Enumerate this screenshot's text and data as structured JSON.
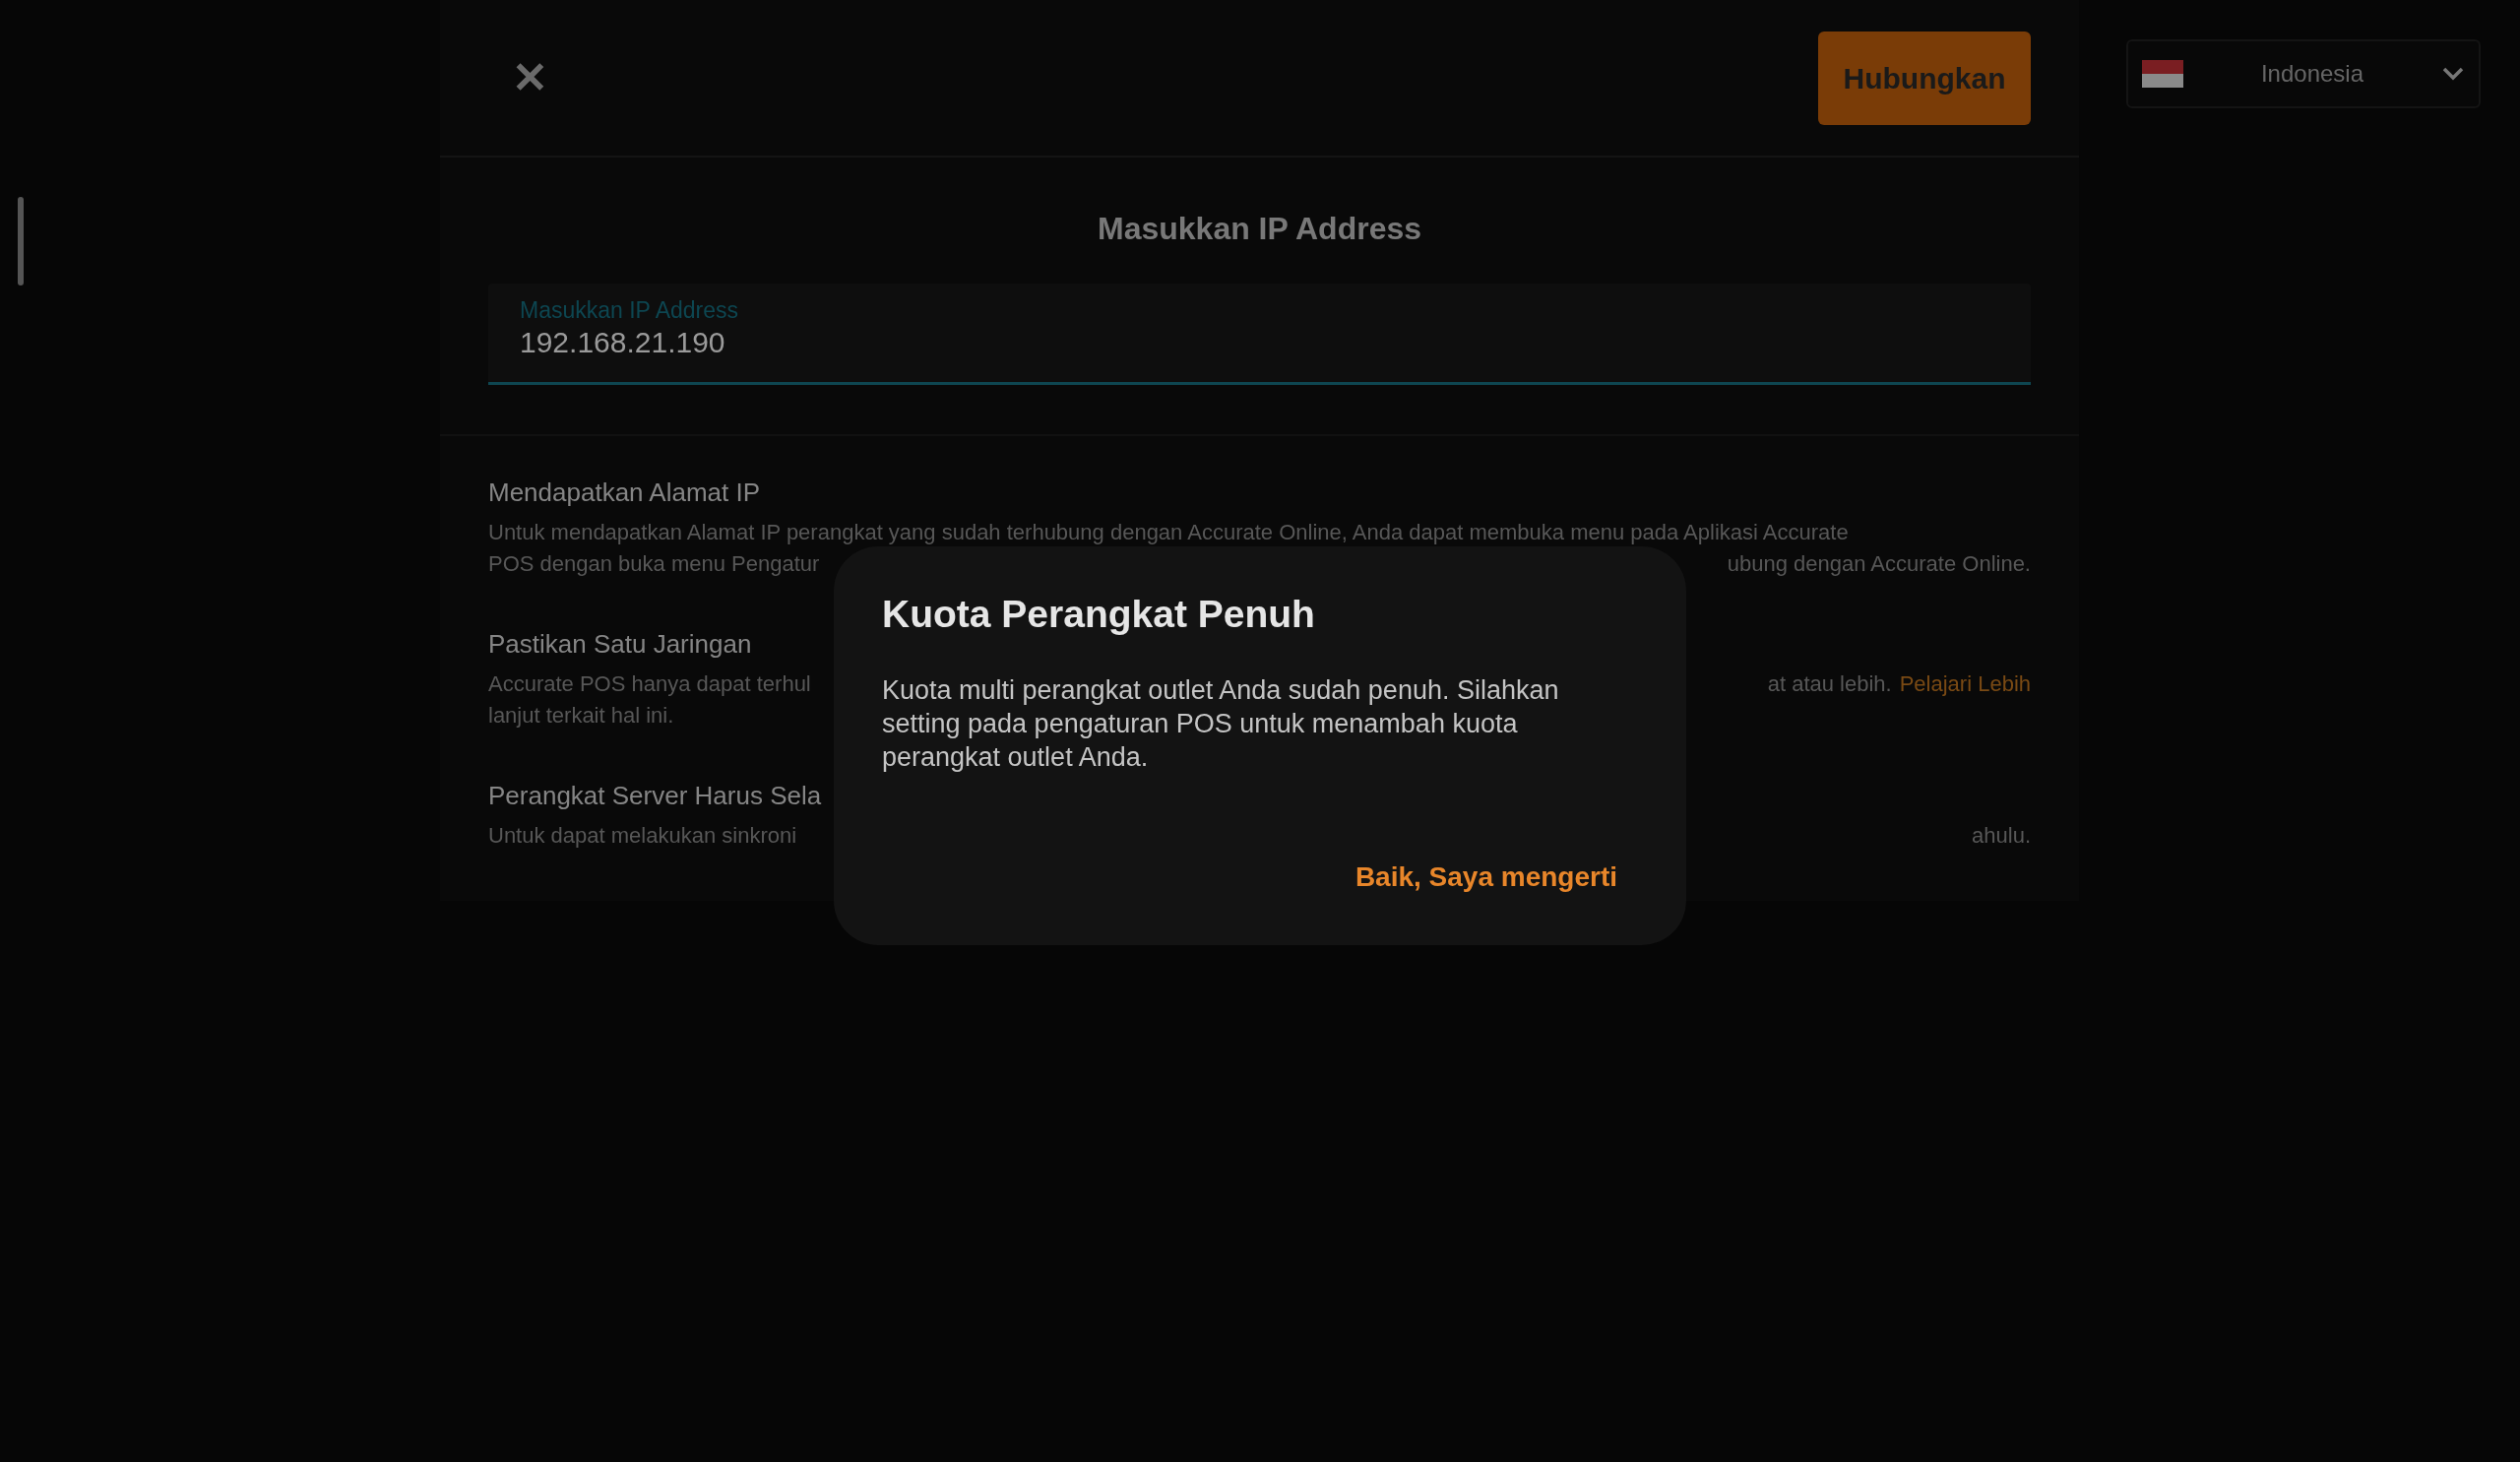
{
  "header": {
    "close_label": "✕",
    "connect_button": "Hubungkan"
  },
  "language": {
    "label": "Indonesia"
  },
  "ip_section": {
    "title": "Masukkan IP Address",
    "field": {
      "label": "Masukkan IP Address",
      "value": "192.168.21.190"
    }
  },
  "help_items": [
    {
      "title": "Mendapatkan Alamat IP",
      "lines": [
        {
          "left": "Untuk mendapatkan Alamat IP perangkat yang sudah terhubung dengan Accurate Online, Anda dapat membuka menu pada Aplikasi Accurate"
        },
        {
          "left": "POS dengan buka menu Pengatur",
          "right": "ubung dengan Accurate Online."
        }
      ]
    },
    {
      "title": "Pastikan Satu Jaringan",
      "lines": [
        {
          "left": "Accurate POS hanya dapat terhul",
          "right": "at atau lebih.",
          "link": "Pelajari Lebih"
        },
        {
          "left": "lanjut terkait hal ini."
        }
      ]
    },
    {
      "title": "Perangkat Server Harus Sela",
      "lines": [
        {
          "left": "Untuk dapat melakukan sinkroni",
          "right": "ahulu."
        }
      ]
    }
  ],
  "dialog": {
    "title": "Kuota Perangkat Penuh",
    "message": "Kuota multi perangkat outlet Anda sudah penuh. Silahkan setting pada pengaturan POS untuk menambah kuota perangkat outlet Anda.",
    "button": "Baik, Saya mengerti"
  }
}
